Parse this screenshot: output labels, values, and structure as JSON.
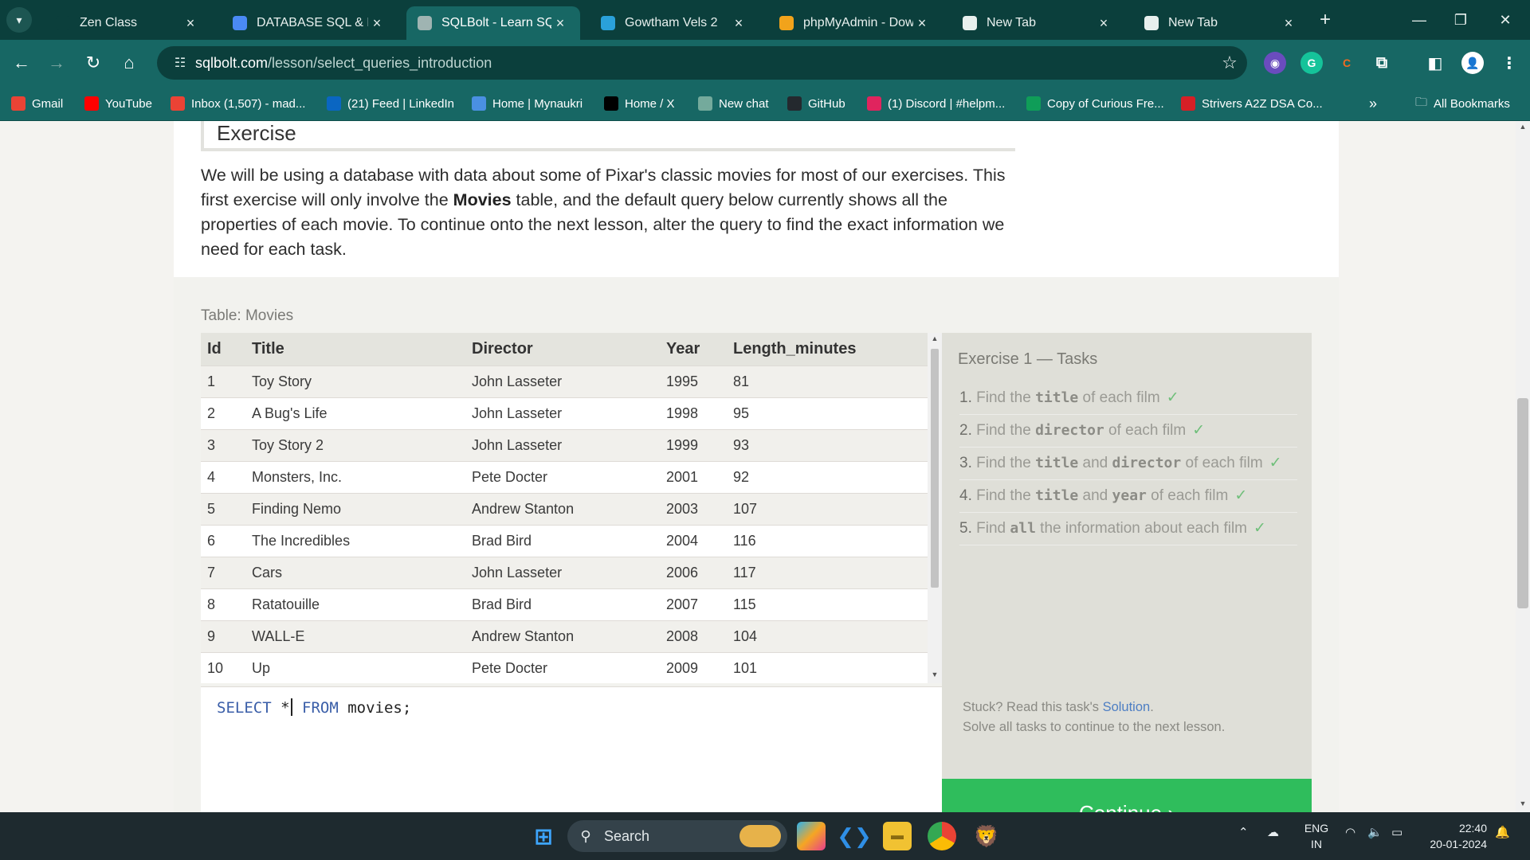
{
  "browser": {
    "tabs": [
      {
        "title": "Zen Class",
        "favicon": "zen-icon",
        "color": "#0b3f3c",
        "active": false
      },
      {
        "title": "DATABASE SQL & NC",
        "favicon": "docs-icon",
        "color": "#4a8af4",
        "active": false
      },
      {
        "title": "SQLBolt - Learn SQL",
        "favicon": "database-icon",
        "color": "#9fb4b2",
        "active": true
      },
      {
        "title": "Gowtham Vels 2",
        "favicon": "telegram-icon",
        "color": "#2aa1da",
        "active": false
      },
      {
        "title": "phpMyAdmin - Dow",
        "favicon": "phpmyadmin-icon",
        "color": "#f2a31b",
        "active": false
      },
      {
        "title": "New Tab",
        "favicon": "chrome-icon",
        "color": "#e8f0ee",
        "active": false
      },
      {
        "title": "New Tab",
        "favicon": "chrome-icon",
        "color": "#e8f0ee",
        "active": false
      }
    ],
    "url_host": "sqlbolt.com",
    "url_path": "/lesson/select_queries_introduction",
    "bookmarks": [
      {
        "label": "Gmail",
        "icon": "gmail-icon",
        "color": "#ea4335"
      },
      {
        "label": "YouTube",
        "icon": "youtube-icon",
        "color": "#ff0000"
      },
      {
        "label": "Inbox (1,507) - mad...",
        "icon": "gmail-icon",
        "color": "#ea4335"
      },
      {
        "label": "(21) Feed | LinkedIn",
        "icon": "linkedin-icon",
        "color": "#0a66c2"
      },
      {
        "label": "Home | Mynaukri",
        "icon": "mynaukri-icon",
        "color": "#4a90e2"
      },
      {
        "label": "Home / X",
        "icon": "x-icon",
        "color": "#000000"
      },
      {
        "label": "New chat",
        "icon": "chatgpt-icon",
        "color": "#74aa9c"
      },
      {
        "label": "GitHub",
        "icon": "github-icon",
        "color": "#24292e"
      },
      {
        "label": "(1) Discord | #helpm...",
        "icon": "discord-icon",
        "color": "#e0245e"
      },
      {
        "label": "Copy of Curious Fre...",
        "icon": "sheets-icon",
        "color": "#0f9d58"
      },
      {
        "label": "Strivers A2Z DSA Co...",
        "icon": "tuf-icon",
        "color": "#d61f26"
      }
    ],
    "all_bookmarks": "All Bookmarks"
  },
  "lesson": {
    "exercise_heading": "Exercise",
    "intro_part1": "We will be using a database with data about some of Pixar's classic movies for most of our exercises. This first exercise will only involve the ",
    "intro_bold": "Movies",
    "intro_part2": " table, and the default query below currently shows all the properties of each movie. To continue onto the next lesson, alter the query to find the exact information we need for each task.",
    "table_caption": "Table: Movies",
    "columns": [
      "Id",
      "Title",
      "Director",
      "Year",
      "Length_minutes"
    ],
    "rows": [
      [
        "1",
        "Toy Story",
        "John Lasseter",
        "1995",
        "81"
      ],
      [
        "2",
        "A Bug's Life",
        "John Lasseter",
        "1998",
        "95"
      ],
      [
        "3",
        "Toy Story 2",
        "John Lasseter",
        "1999",
        "93"
      ],
      [
        "4",
        "Monsters, Inc.",
        "Pete Docter",
        "2001",
        "92"
      ],
      [
        "5",
        "Finding Nemo",
        "Andrew Stanton",
        "2003",
        "107"
      ],
      [
        "6",
        "The Incredibles",
        "Brad Bird",
        "2004",
        "116"
      ],
      [
        "7",
        "Cars",
        "John Lasseter",
        "2006",
        "117"
      ],
      [
        "8",
        "Ratatouille",
        "Brad Bird",
        "2007",
        "115"
      ],
      [
        "9",
        "WALL-E",
        "Andrew Stanton",
        "2008",
        "104"
      ],
      [
        "10",
        "Up",
        "Pete Docter",
        "2009",
        "101"
      ]
    ],
    "query": {
      "select": "SELECT",
      "star": "*",
      "from": "FROM",
      "rest": "movies;"
    },
    "tasks_title": "Exercise 1 — Tasks",
    "tasks": [
      {
        "num": "1.",
        "parts": [
          "Find the ",
          "title",
          " of each film"
        ],
        "done": true
      },
      {
        "num": "2.",
        "parts": [
          "Find the ",
          "director",
          " of each film"
        ],
        "done": true
      },
      {
        "num": "3.",
        "parts": [
          "Find the ",
          "title",
          " and ",
          "director",
          " of each film"
        ],
        "done": true
      },
      {
        "num": "4.",
        "parts": [
          "Find the ",
          "title",
          " and ",
          "year",
          " of each film"
        ],
        "done": true
      },
      {
        "num": "5.",
        "parts": [
          "Find ",
          "all",
          " the information about each film"
        ],
        "done": true
      }
    ],
    "check_mark": "✓",
    "stuck_text": "Stuck? Read this task's ",
    "solution_link": "Solution",
    "stuck_end": ".",
    "solve_all_text": "Solve all tasks to continue to the next lesson.",
    "continue_label": "Continue ›"
  },
  "taskbar": {
    "search_placeholder": "Search",
    "lang_top": "ENG",
    "lang_bottom": "IN",
    "time": "22:40",
    "date": "20-01-2024"
  }
}
